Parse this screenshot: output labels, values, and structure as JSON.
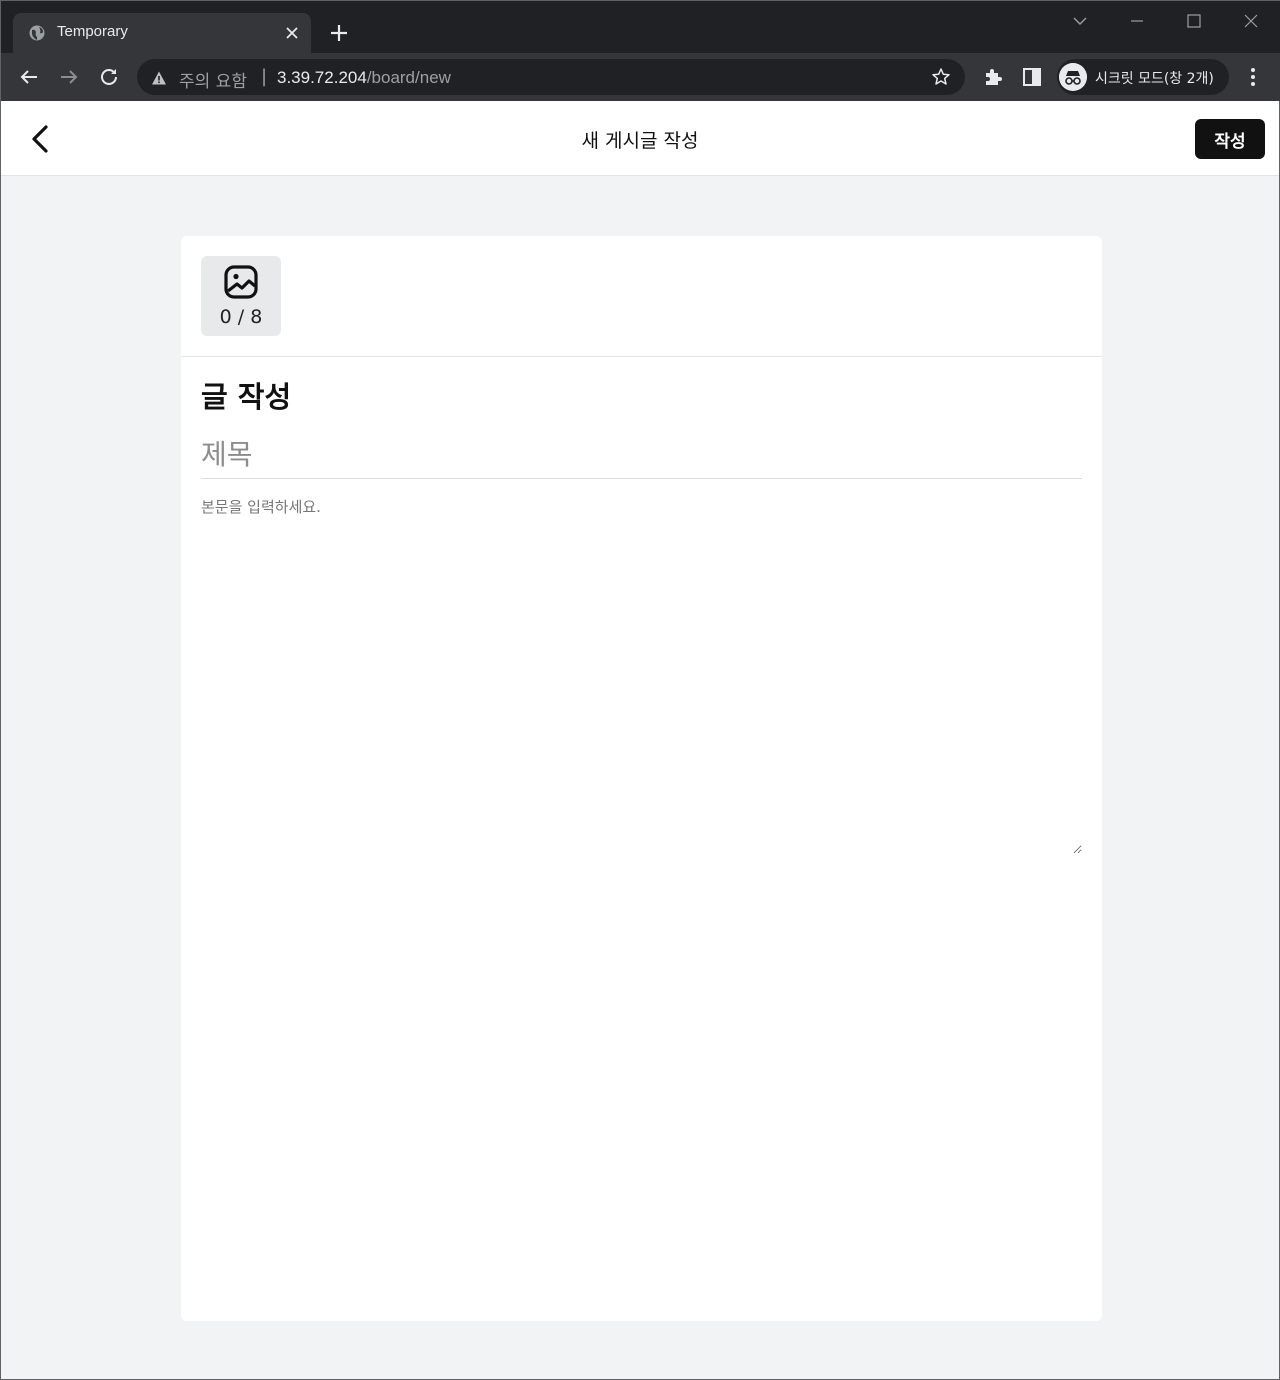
{
  "browser": {
    "tab_title": "Temporary",
    "security_warning": "주의 요함",
    "url_separator": "|",
    "url_host": "3.39.72.204",
    "url_path": "/board/new",
    "incognito_label": "시크릿 모드(창 2개)"
  },
  "header": {
    "title": "새 게시글 작성",
    "submit_label": "작성"
  },
  "editor": {
    "photo_count": "0 / 8",
    "section_title": "글 작성",
    "title_placeholder": "제목",
    "body_placeholder": "본문을 입력하세요."
  },
  "colors": {
    "page_background": "#f2f3f4",
    "submit_button": "#111111",
    "chrome_dark": "#202124",
    "chrome_toolbar": "#35363a"
  }
}
